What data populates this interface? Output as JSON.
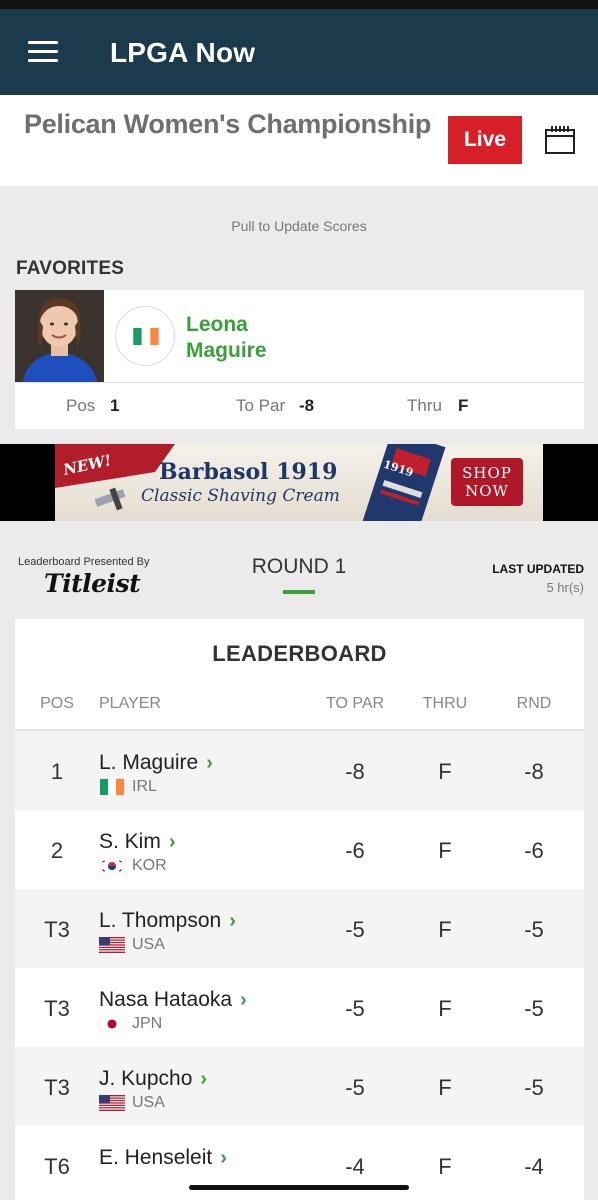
{
  "app": {
    "title": "LPGA Now"
  },
  "event": {
    "title": "Pelican Women's Championship",
    "live_label": "Live"
  },
  "pull_to_update": "Pull to Update Scores",
  "favorites": {
    "label": "FAVORITES",
    "player": {
      "first_name": "Leona",
      "last_name": "Maguire",
      "pos_label": "Pos",
      "pos": "1",
      "topar_label": "To Par",
      "topar": "-8",
      "thru_label": "Thru",
      "thru": "F"
    }
  },
  "ad": {
    "new_label": "NEW!",
    "brand": "Barbasol 1919",
    "product": "Classic Shaving Cream",
    "cta_line1": "SHOP",
    "cta_line2": "NOW",
    "tube_label": "1919"
  },
  "sponsor": {
    "presented_by": "Leaderboard Presented By",
    "logo_text": "Titleist"
  },
  "round": {
    "label": "ROUND 1"
  },
  "last_updated": {
    "label": "LAST UPDATED",
    "value": "5 hr(s)"
  },
  "leaderboard": {
    "title": "LEADERBOARD",
    "columns": {
      "pos": "POS",
      "player": "PLAYER",
      "topar": "TO PAR",
      "thru": "THRU",
      "rnd": "RND"
    },
    "rows": [
      {
        "pos": "1",
        "name": "L. Maguire",
        "country": "IRL",
        "topar": "-8",
        "thru": "F",
        "rnd": "-8"
      },
      {
        "pos": "2",
        "name": "S. Kim",
        "country": "KOR",
        "topar": "-6",
        "thru": "F",
        "rnd": "-6"
      },
      {
        "pos": "T3",
        "name": "L. Thompson",
        "country": "USA",
        "topar": "-5",
        "thru": "F",
        "rnd": "-5"
      },
      {
        "pos": "T3",
        "name": "Nasa Hataoka",
        "country": "JPN",
        "topar": "-5",
        "thru": "F",
        "rnd": "-5"
      },
      {
        "pos": "T3",
        "name": "J. Kupcho",
        "country": "USA",
        "topar": "-5",
        "thru": "F",
        "rnd": "-5"
      },
      {
        "pos": "T6",
        "name": "E. Henseleit",
        "country": "",
        "topar": "-4",
        "thru": "F",
        "rnd": "-4"
      }
    ]
  },
  "colors": {
    "app_bar": "#1b3a4b",
    "live": "#d72027",
    "accent_green": "#3aa13a"
  }
}
